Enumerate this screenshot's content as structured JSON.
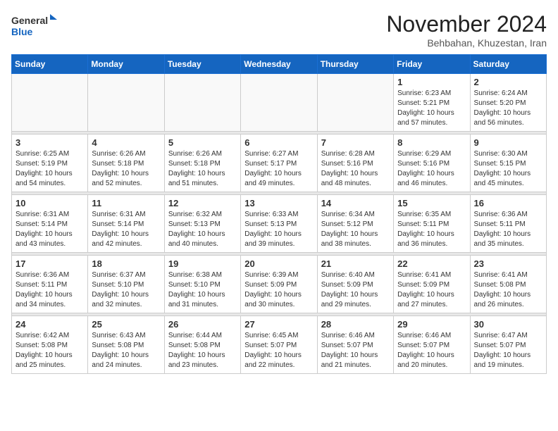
{
  "logo": {
    "general": "General",
    "blue": "Blue"
  },
  "header": {
    "month": "November 2024",
    "location": "Behbahan, Khuzestan, Iran"
  },
  "weekdays": [
    "Sunday",
    "Monday",
    "Tuesday",
    "Wednesday",
    "Thursday",
    "Friday",
    "Saturday"
  ],
  "weeks": [
    [
      {
        "day": "",
        "info": ""
      },
      {
        "day": "",
        "info": ""
      },
      {
        "day": "",
        "info": ""
      },
      {
        "day": "",
        "info": ""
      },
      {
        "day": "",
        "info": ""
      },
      {
        "day": "1",
        "info": "Sunrise: 6:23 AM\nSunset: 5:21 PM\nDaylight: 10 hours and 57 minutes."
      },
      {
        "day": "2",
        "info": "Sunrise: 6:24 AM\nSunset: 5:20 PM\nDaylight: 10 hours and 56 minutes."
      }
    ],
    [
      {
        "day": "3",
        "info": "Sunrise: 6:25 AM\nSunset: 5:19 PM\nDaylight: 10 hours and 54 minutes."
      },
      {
        "day": "4",
        "info": "Sunrise: 6:26 AM\nSunset: 5:18 PM\nDaylight: 10 hours and 52 minutes."
      },
      {
        "day": "5",
        "info": "Sunrise: 6:26 AM\nSunset: 5:18 PM\nDaylight: 10 hours and 51 minutes."
      },
      {
        "day": "6",
        "info": "Sunrise: 6:27 AM\nSunset: 5:17 PM\nDaylight: 10 hours and 49 minutes."
      },
      {
        "day": "7",
        "info": "Sunrise: 6:28 AM\nSunset: 5:16 PM\nDaylight: 10 hours and 48 minutes."
      },
      {
        "day": "8",
        "info": "Sunrise: 6:29 AM\nSunset: 5:16 PM\nDaylight: 10 hours and 46 minutes."
      },
      {
        "day": "9",
        "info": "Sunrise: 6:30 AM\nSunset: 5:15 PM\nDaylight: 10 hours and 45 minutes."
      }
    ],
    [
      {
        "day": "10",
        "info": "Sunrise: 6:31 AM\nSunset: 5:14 PM\nDaylight: 10 hours and 43 minutes."
      },
      {
        "day": "11",
        "info": "Sunrise: 6:31 AM\nSunset: 5:14 PM\nDaylight: 10 hours and 42 minutes."
      },
      {
        "day": "12",
        "info": "Sunrise: 6:32 AM\nSunset: 5:13 PM\nDaylight: 10 hours and 40 minutes."
      },
      {
        "day": "13",
        "info": "Sunrise: 6:33 AM\nSunset: 5:13 PM\nDaylight: 10 hours and 39 minutes."
      },
      {
        "day": "14",
        "info": "Sunrise: 6:34 AM\nSunset: 5:12 PM\nDaylight: 10 hours and 38 minutes."
      },
      {
        "day": "15",
        "info": "Sunrise: 6:35 AM\nSunset: 5:11 PM\nDaylight: 10 hours and 36 minutes."
      },
      {
        "day": "16",
        "info": "Sunrise: 6:36 AM\nSunset: 5:11 PM\nDaylight: 10 hours and 35 minutes."
      }
    ],
    [
      {
        "day": "17",
        "info": "Sunrise: 6:36 AM\nSunset: 5:11 PM\nDaylight: 10 hours and 34 minutes."
      },
      {
        "day": "18",
        "info": "Sunrise: 6:37 AM\nSunset: 5:10 PM\nDaylight: 10 hours and 32 minutes."
      },
      {
        "day": "19",
        "info": "Sunrise: 6:38 AM\nSunset: 5:10 PM\nDaylight: 10 hours and 31 minutes."
      },
      {
        "day": "20",
        "info": "Sunrise: 6:39 AM\nSunset: 5:09 PM\nDaylight: 10 hours and 30 minutes."
      },
      {
        "day": "21",
        "info": "Sunrise: 6:40 AM\nSunset: 5:09 PM\nDaylight: 10 hours and 29 minutes."
      },
      {
        "day": "22",
        "info": "Sunrise: 6:41 AM\nSunset: 5:09 PM\nDaylight: 10 hours and 27 minutes."
      },
      {
        "day": "23",
        "info": "Sunrise: 6:41 AM\nSunset: 5:08 PM\nDaylight: 10 hours and 26 minutes."
      }
    ],
    [
      {
        "day": "24",
        "info": "Sunrise: 6:42 AM\nSunset: 5:08 PM\nDaylight: 10 hours and 25 minutes."
      },
      {
        "day": "25",
        "info": "Sunrise: 6:43 AM\nSunset: 5:08 PM\nDaylight: 10 hours and 24 minutes."
      },
      {
        "day": "26",
        "info": "Sunrise: 6:44 AM\nSunset: 5:08 PM\nDaylight: 10 hours and 23 minutes."
      },
      {
        "day": "27",
        "info": "Sunrise: 6:45 AM\nSunset: 5:07 PM\nDaylight: 10 hours and 22 minutes."
      },
      {
        "day": "28",
        "info": "Sunrise: 6:46 AM\nSunset: 5:07 PM\nDaylight: 10 hours and 21 minutes."
      },
      {
        "day": "29",
        "info": "Sunrise: 6:46 AM\nSunset: 5:07 PM\nDaylight: 10 hours and 20 minutes."
      },
      {
        "day": "30",
        "info": "Sunrise: 6:47 AM\nSunset: 5:07 PM\nDaylight: 10 hours and 19 minutes."
      }
    ]
  ]
}
